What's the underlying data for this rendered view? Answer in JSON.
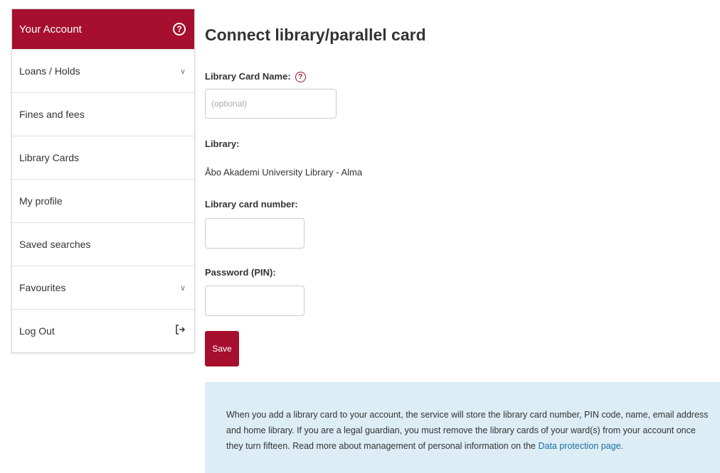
{
  "sidebar": {
    "header": {
      "label": "Your Account",
      "icon": "help-circle-icon"
    },
    "items": [
      {
        "label": "Loans / Holds",
        "icon": "chevron-down-icon"
      },
      {
        "label": "Fines and fees"
      },
      {
        "label": "Library Cards"
      },
      {
        "label": "My profile"
      },
      {
        "label": "Saved searches"
      },
      {
        "label": "Favourites",
        "icon": "chevron-down-icon"
      },
      {
        "label": "Log Out",
        "icon": "logout-icon"
      }
    ]
  },
  "main": {
    "title": "Connect library/parallel card",
    "card_name": {
      "label": "Library Card Name:",
      "placeholder": "(optional)",
      "value": ""
    },
    "library": {
      "label": "Library:",
      "value": "Åbo Akademi University Library - Alma"
    },
    "card_number": {
      "label": "Library card number:",
      "value": ""
    },
    "password": {
      "label": "Password (PIN):",
      "value": ""
    },
    "save_label": "Save",
    "info": {
      "text": "When you add a library card to your account, the service will store the library card number, PIN code, name, email address and home library. If you are a legal guardian, you must remove the library cards of your ward(s) from your account once they turn fifteen. Read more about management of personal information on the ",
      "link": "Data protection page",
      "end": "."
    }
  },
  "colors": {
    "brand": "#a60f2d",
    "info_bg": "#dcedf6",
    "link": "#1f6fa3"
  }
}
